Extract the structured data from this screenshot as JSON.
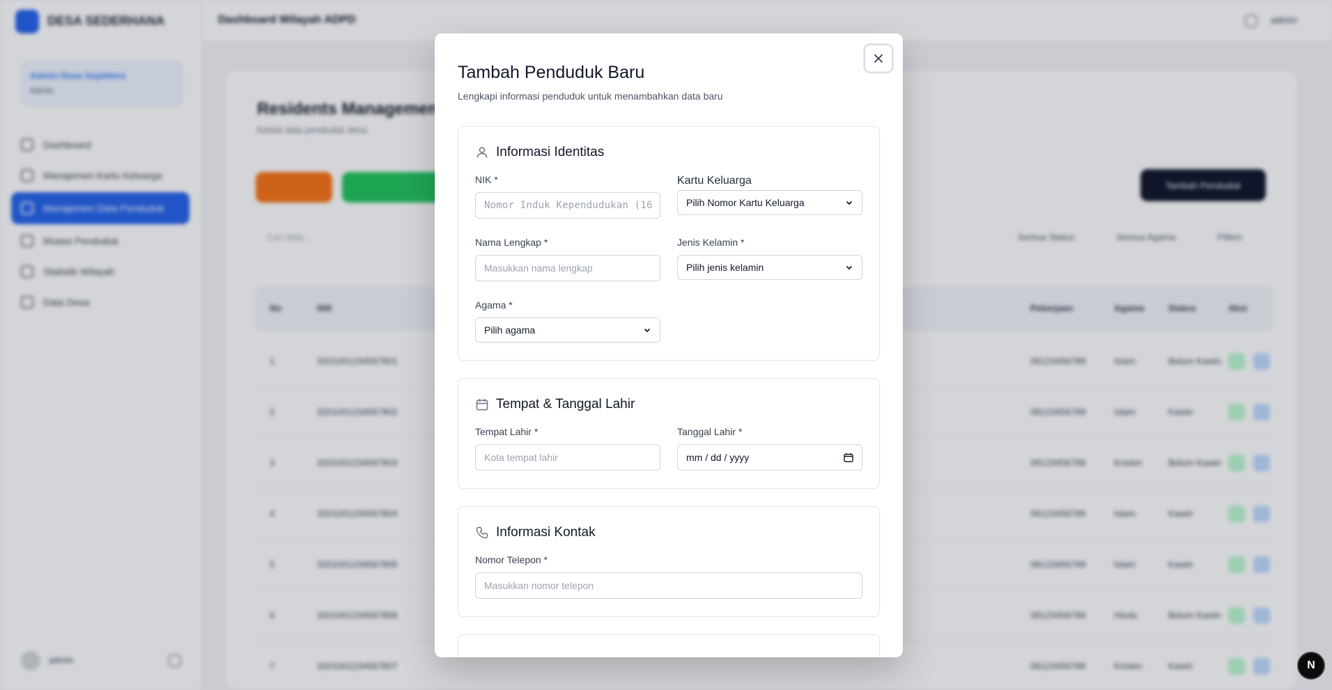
{
  "background": {
    "brand": "DESA SEDERHANA",
    "user_card": {
      "name": "Admin Desa Sejahtera",
      "role": "Admin"
    },
    "nav_items": [
      "Dashboard",
      "Manajemen Kartu Keluarga",
      "Manajemen Data Penduduk",
      "Mutasi Penduduk",
      "Statistik Wilayah",
      "Data Desa"
    ],
    "footer_user": "admin",
    "topbar_title": "Dashboard Wilayah ADPD",
    "topbar_user": "admin",
    "page_title": "Residents Management",
    "page_subtitle": "Kelola data penduduk desa",
    "add_button": "Tambah Penduduk",
    "search_placeholder": "Cari data...",
    "filters": [
      "Semua Status",
      "Semua Agama",
      "Filters"
    ],
    "table_headers": [
      "No",
      "NIK",
      "Pekerjaan",
      "Agama",
      "Status",
      "Aksi"
    ],
    "rows": [
      {
        "no": "1",
        "nik": "3201001234567801",
        "job": "08123456789",
        "religion": "Islam",
        "status": "Belum Kawin"
      },
      {
        "no": "2",
        "nik": "3201001234567802",
        "job": "08123456789",
        "religion": "Islam",
        "status": "Kawin"
      },
      {
        "no": "3",
        "nik": "3201001234567803",
        "job": "08123456789",
        "religion": "Kristen",
        "status": "Belum Kawin"
      },
      {
        "no": "4",
        "nik": "3201001234567804",
        "job": "08123456789",
        "religion": "Islam",
        "status": "Kawin"
      },
      {
        "no": "5",
        "nik": "3201001234567805",
        "job": "08123456789",
        "religion": "Islam",
        "status": "Kawin"
      },
      {
        "no": "6",
        "nik": "3201001234567806",
        "job": "08123456789",
        "religion": "Hindu",
        "status": "Belum Kawin"
      },
      {
        "no": "7",
        "nik": "3201001234567807",
        "job": "08123456789",
        "religion": "Kristen",
        "status": "Kawin"
      }
    ]
  },
  "modal": {
    "title": "Tambah Penduduk Baru",
    "description": "Lengkapi informasi penduduk untuk menambahkan data baru",
    "sections": {
      "identity": {
        "title": "Informasi Identitas",
        "nik_label": "NIK *",
        "nik_placeholder": "Nomor Induk Kependudukan (16",
        "kk_label": "Kartu Keluarga",
        "kk_value": "Pilih Nomor Kartu Keluarga",
        "name_label": "Nama Lengkap *",
        "name_placeholder": "Masukkan nama lengkap",
        "gender_label": "Jenis Kelamin *",
        "gender_value": "Pilih jenis kelamin",
        "religion_label": "Agama *",
        "religion_value": "Pilih agama"
      },
      "birth": {
        "title": "Tempat & Tanggal Lahir",
        "place_label": "Tempat Lahir *",
        "place_placeholder": "Kota tempat lahir",
        "date_label": "Tanggal Lahir *",
        "date_value": "mm / dd / yyyy"
      },
      "contact": {
        "title": "Informasi Kontak",
        "phone_label": "Nomor Telepon *",
        "phone_placeholder": "Masukkan nomor telepon"
      }
    }
  },
  "next_badge": "N",
  "colors": {
    "primary": "#2563eb",
    "orange": "#f97316",
    "green": "#22c55e",
    "dark": "#0f172a"
  }
}
